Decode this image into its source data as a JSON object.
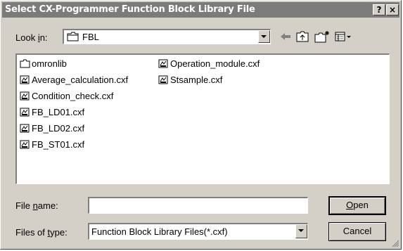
{
  "window": {
    "title": "Select CX-Programmer Function Block Library File",
    "help_label": "?",
    "close_label": "×"
  },
  "lookin": {
    "label_pre": "Look ",
    "label_u": "i",
    "label_post": "n:",
    "value": "FBL",
    "icon": "folder-icon"
  },
  "toolbar": {
    "icons": [
      "back-arrow-icon",
      "up-folder-icon",
      "new-folder-icon",
      "view-menu-icon"
    ]
  },
  "files": [
    {
      "name": "omronlib",
      "type": "folder"
    },
    {
      "name": "Average_calculation.cxf",
      "type": "file"
    },
    {
      "name": "Condition_check.cxf",
      "type": "file"
    },
    {
      "name": "FB_LD01.cxf",
      "type": "file"
    },
    {
      "name": "FB_LD02.cxf",
      "type": "file"
    },
    {
      "name": "FB_ST01.cxf",
      "type": "file"
    },
    {
      "name": "Operation_module.cxf",
      "type": "file"
    },
    {
      "name": "Stsample.cxf",
      "type": "file"
    }
  ],
  "filename": {
    "label_pre": "File ",
    "label_u": "n",
    "label_post": "ame:",
    "value": ""
  },
  "filetype": {
    "label_pre": "Files of ",
    "label_u": "t",
    "label_post": "ype:",
    "value": "Function Block Library Files(*.cxf)"
  },
  "buttons": {
    "open_u": "O",
    "open_rest": "pen",
    "cancel": "Cancel"
  }
}
